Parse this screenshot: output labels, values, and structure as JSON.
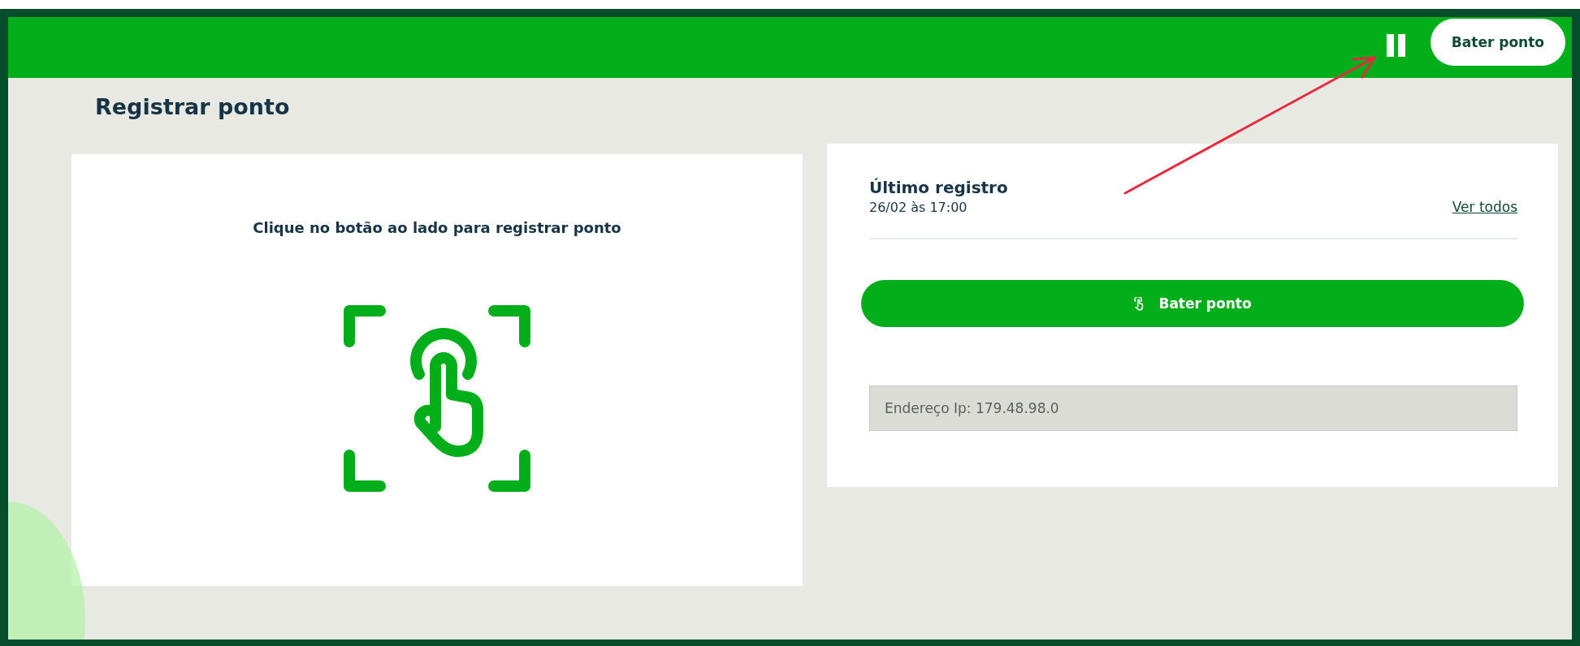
{
  "header": {
    "button": "Bater ponto"
  },
  "page_title": "Registrar ponto",
  "left_card": {
    "instruction": "Clique no botão ao lado para registrar ponto"
  },
  "right_card": {
    "title": "Último registro",
    "last_record": "26/02 às 17:00",
    "link": "Ver todos",
    "button": "Bater ponto",
    "ip_field": "Endereço Ip: 179.48.98.0"
  }
}
